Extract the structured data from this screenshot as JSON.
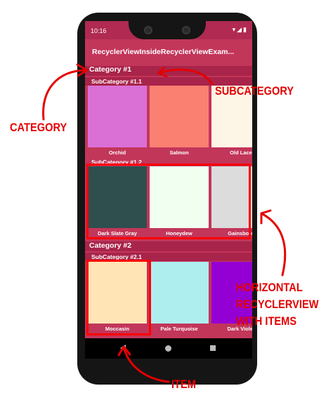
{
  "status_bar": {
    "time": "10:16",
    "icons": "▾◢▮"
  },
  "app_bar": {
    "title": "RecyclerViewInsideRecyclerViewExam..."
  },
  "categories": [
    {
      "title": "Category #1",
      "subcategories": [
        {
          "title": "SubCategory #1.1",
          "items": [
            {
              "name": "Orchid",
              "color": "#DA70D6"
            },
            {
              "name": "Salmon",
              "color": "#FA8072"
            },
            {
              "name": "Old Lace",
              "color": "#FDF5E6"
            }
          ]
        },
        {
          "title": "SubCategory #1.2",
          "items": [
            {
              "name": "Dark Slate Gray",
              "color": "#2F4F4F"
            },
            {
              "name": "Honeydew",
              "color": "#F0FFF0"
            },
            {
              "name": "Gainsboro",
              "color": "#DCDCDC"
            }
          ]
        }
      ]
    },
    {
      "title": "Category #2",
      "subcategories": [
        {
          "title": "SubCategory #2.1",
          "items": [
            {
              "name": "Moccasin",
              "color": "#FFE4B5"
            },
            {
              "name": "Pale Turquoise",
              "color": "#AFEEEE"
            },
            {
              "name": "Dark Violet",
              "color": "#9400D3"
            }
          ]
        }
      ]
    }
  ],
  "annotations": {
    "category": "CATEGORY",
    "subcategory": "SUBCATEGORY",
    "horizontal": [
      "HORIZONTAL",
      "RECYCLERVIEW",
      "WITH ITEMS"
    ],
    "item": "ITEM"
  },
  "colors": {
    "primary": "#C2365A",
    "primary_dark": "#B02A52",
    "annotation_red": "#E40000"
  }
}
